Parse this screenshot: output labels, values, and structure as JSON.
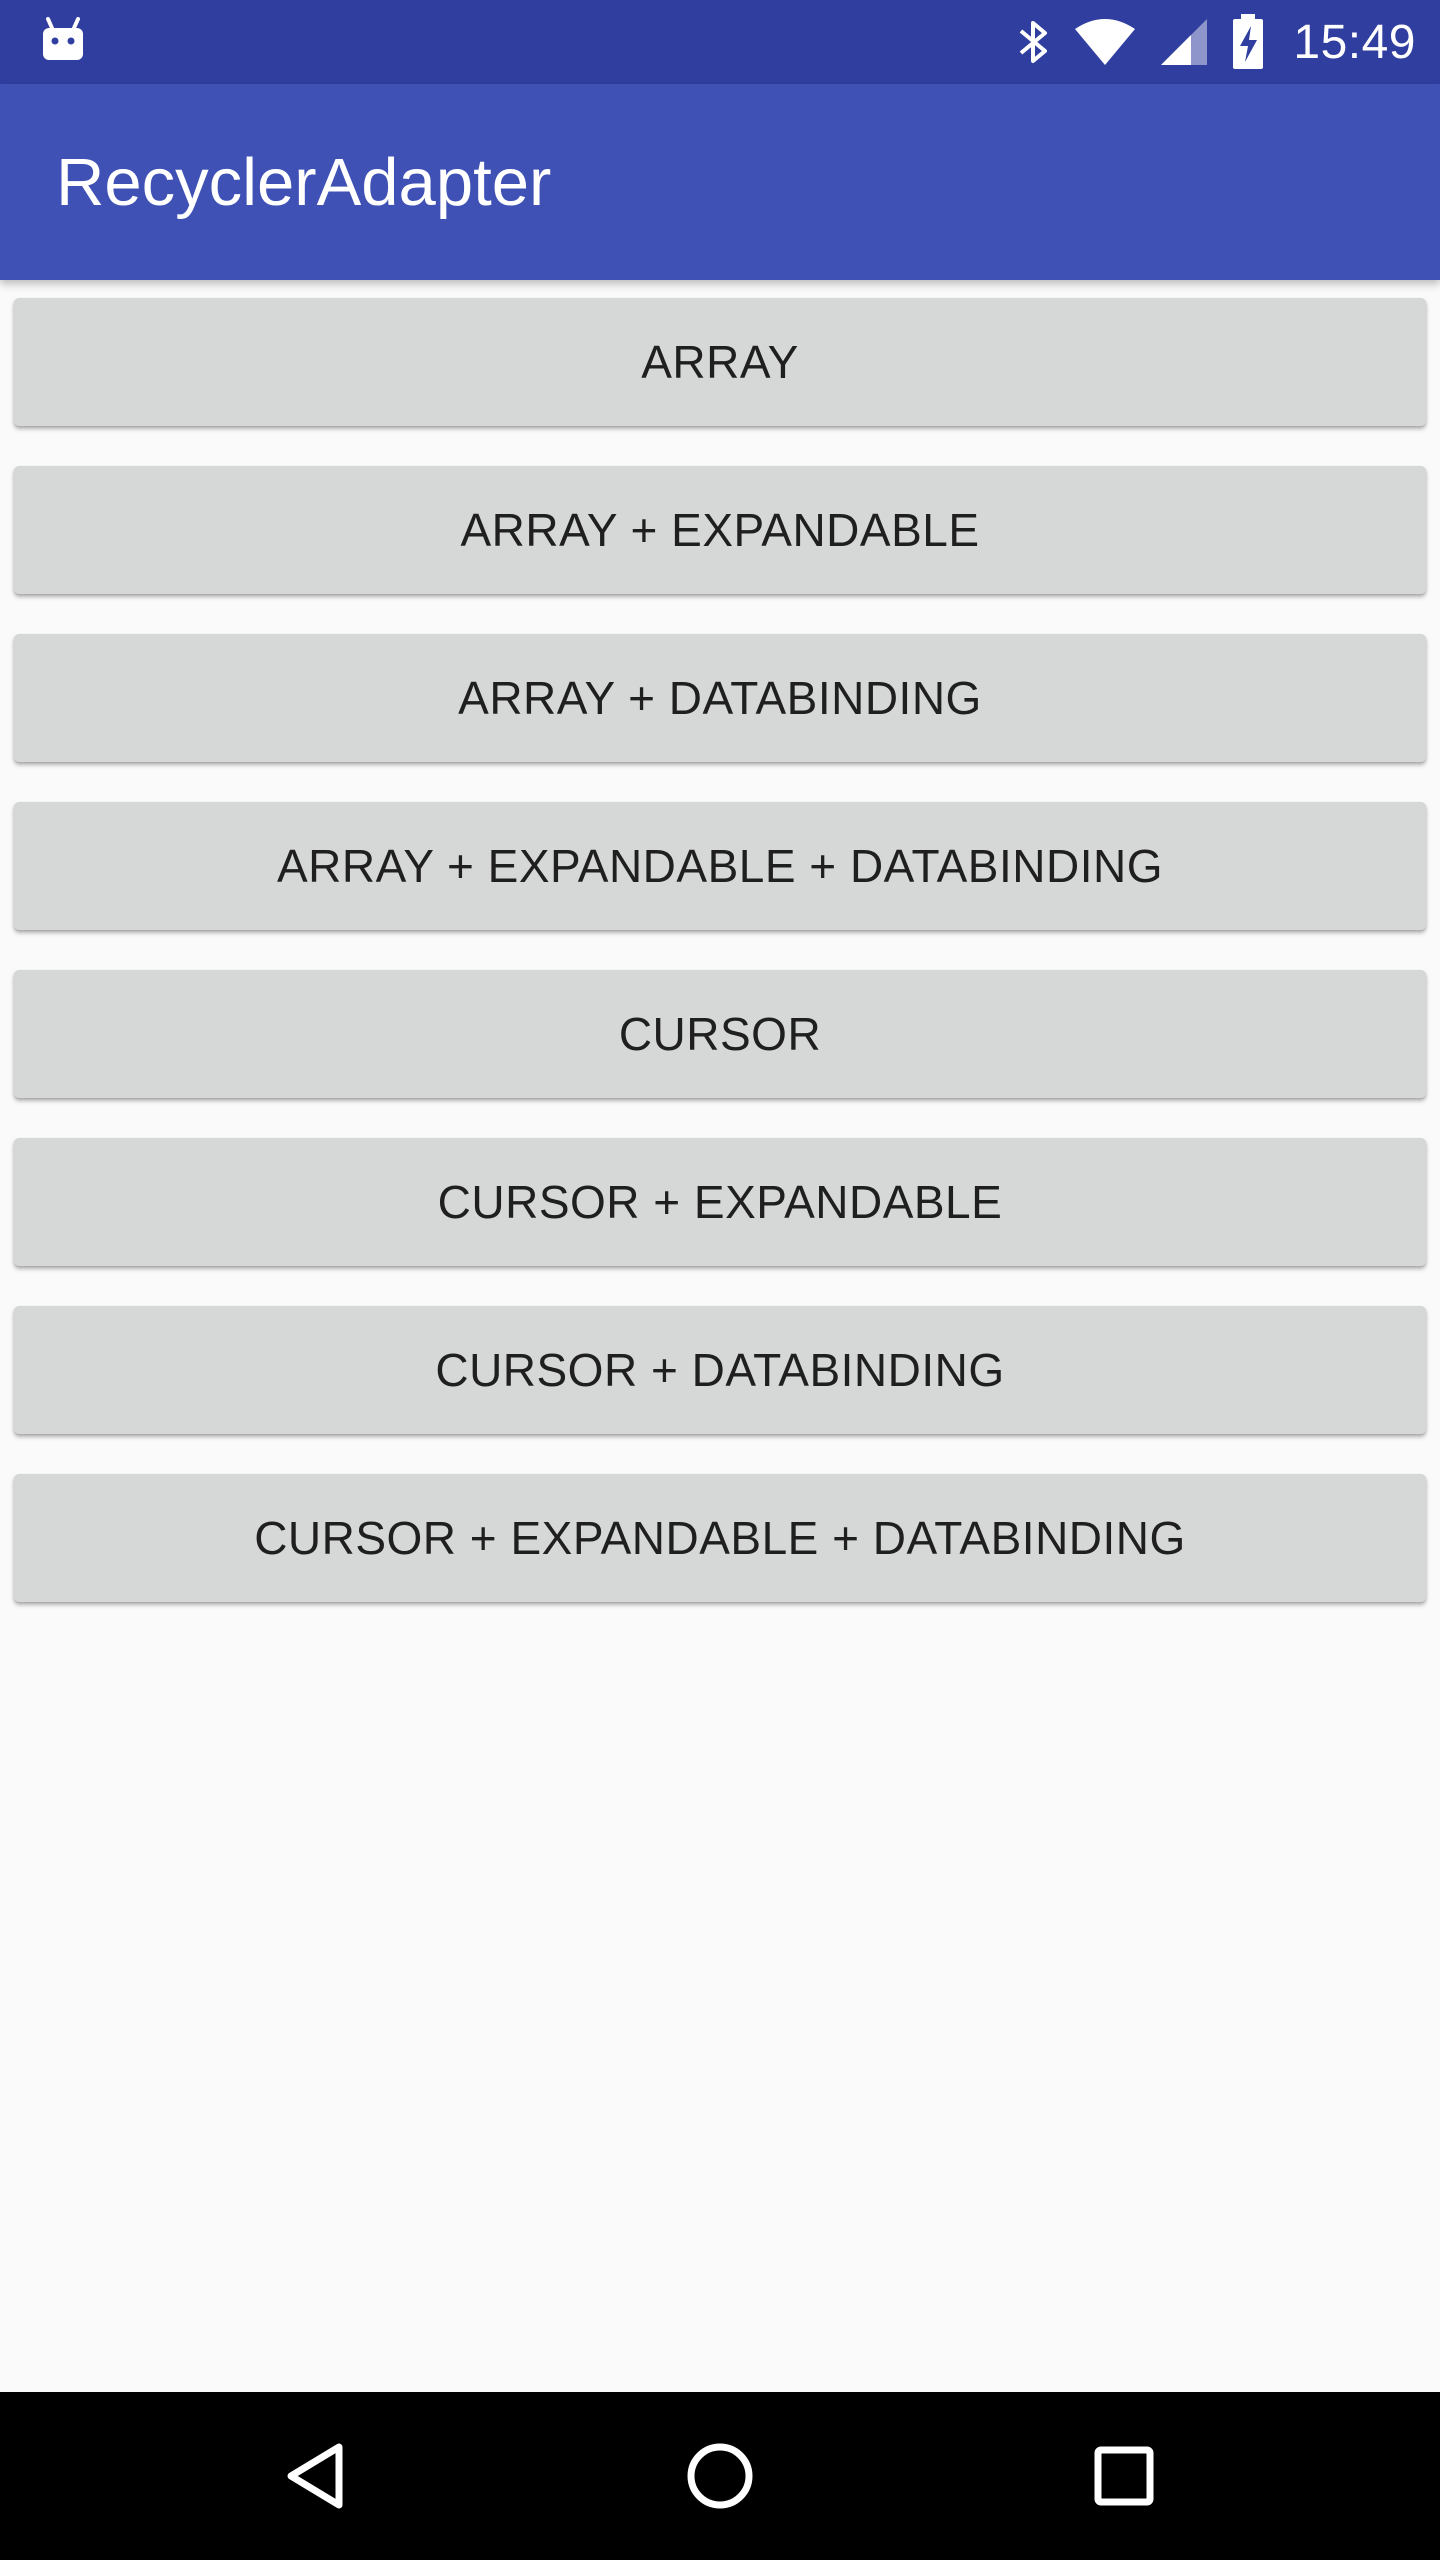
{
  "status_bar": {
    "time": "15:49",
    "icons": [
      "android-debug-icon",
      "bluetooth-icon",
      "wifi-icon",
      "cell-signal-icon",
      "battery-charging-icon"
    ]
  },
  "app_bar": {
    "title": "RecyclerAdapter"
  },
  "buttons": [
    "ARRAY",
    "ARRAY + EXPANDABLE",
    "ARRAY + DATABINDING",
    "ARRAY + EXPANDABLE + DATABINDING",
    "CURSOR",
    "CURSOR + EXPANDABLE",
    "CURSOR + DATABINDING",
    "CURSOR + EXPANDABLE + DATABINDING"
  ],
  "nav_bar": {
    "icons": [
      "back-icon",
      "home-icon",
      "recents-icon"
    ]
  },
  "colors": {
    "status_bar": "#303f9f",
    "app_bar": "#3f51b5",
    "background": "#fafafa",
    "button": "#d6d7d7",
    "button_text": "#1f1f1f",
    "nav_bar": "#000000"
  }
}
